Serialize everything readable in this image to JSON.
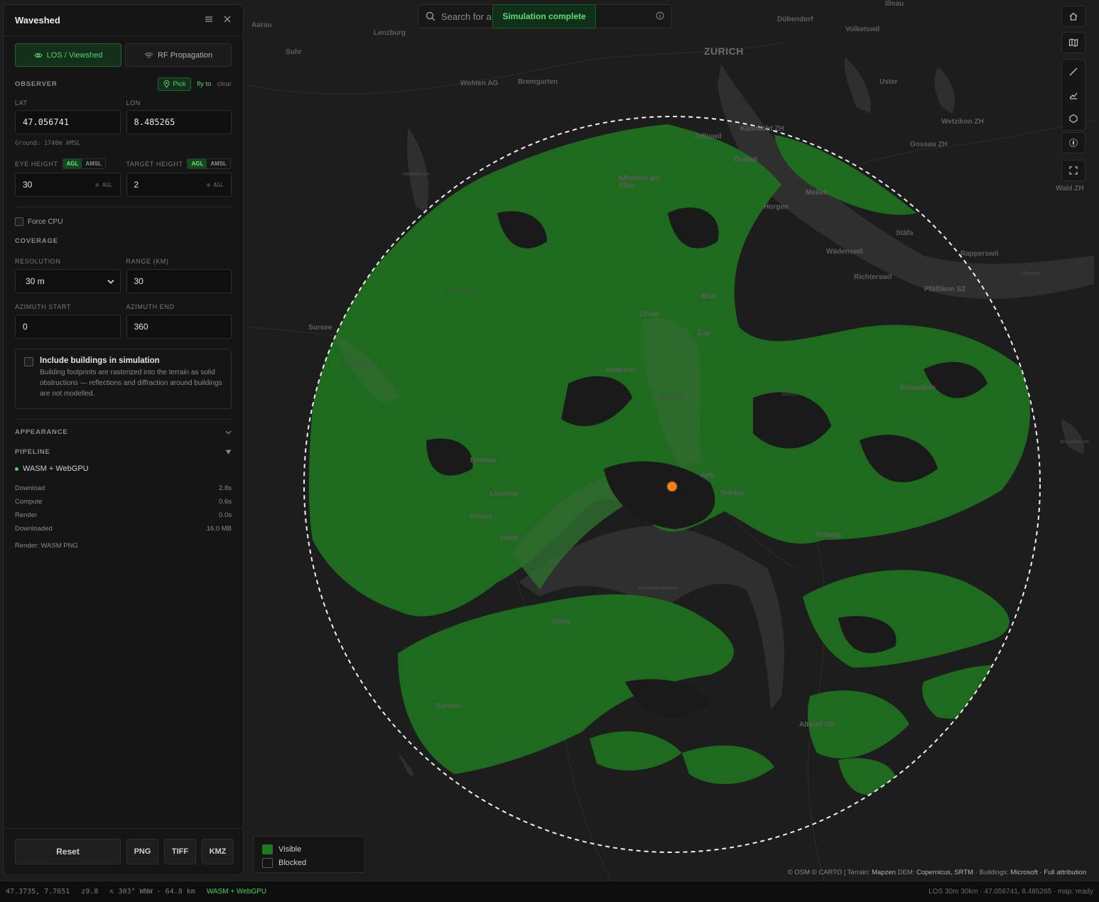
{
  "panel": {
    "title": "Waveshed",
    "tabs": [
      {
        "label": "LOS / Viewshed",
        "icon": "eye-icon",
        "active": true
      },
      {
        "label": "RF Propagation",
        "icon": "wifi-icon",
        "active": false
      }
    ],
    "observer": {
      "section": "OBSERVER",
      "pick": "Pick",
      "fly_to": "fly to",
      "clear": "clear",
      "lat_label": "LAT",
      "lon_label": "LON",
      "lat": "47.056741",
      "lon": "8.485265",
      "ground": "Ground: 1748m AMSL"
    },
    "heights": {
      "eye_label": "EYE HEIGHT",
      "target_label": "TARGET HEIGHT",
      "agl": "AGL",
      "amsl": "AMSL",
      "eye_value": "30",
      "target_value": "2",
      "unit": "m AGL"
    },
    "force_cpu": "Force CPU",
    "coverage": {
      "section": "COVERAGE",
      "resolution_label": "RESOLUTION",
      "resolution_value": "30 m",
      "range_label": "RANGE (KM)",
      "range_value": "30",
      "az_start_label": "AZIMUTH START",
      "az_start_value": "0",
      "az_end_label": "AZIMUTH END",
      "az_end_value": "360"
    },
    "buildings": {
      "title": "Include buildings in simulation",
      "desc": "Building footprints are rasterized into the terrain as solid obstructions — reflections and diffraction around buildings are not modelled."
    },
    "appearance": "APPEARANCE",
    "pipeline": {
      "section": "PIPELINE",
      "engine": "WASM + WebGPU",
      "stats": [
        {
          "label": "Download",
          "value": "2.8s"
        },
        {
          "label": "Compute",
          "value": "0.6s"
        },
        {
          "label": "Render",
          "value": "0.0s"
        },
        {
          "label": "Downloaded",
          "value": "16.0 MB"
        }
      ],
      "render_mode": "Render: WASM PNG"
    },
    "buttons": {
      "reset": "Reset",
      "png": "PNG",
      "tiff": "TIFF",
      "kmz": "KMZ"
    }
  },
  "search": {
    "placeholder": "Search for a pla"
  },
  "toast": "Simulation complete",
  "legend": {
    "visible": "Visible",
    "blocked": "Blocked",
    "visible_color": "#1f7a1f"
  },
  "map_labels": [
    "Illnau",
    "Aarau",
    "Lenzburg",
    "Dübendorf",
    "Volketswil",
    "Suhr",
    "ZURICH",
    "Wohlen AG",
    "Bremgarten",
    "Uster",
    "Adliswil",
    "Küsnacht ZH",
    "Wetzikon ZH",
    "Gossau ZH",
    "Thalwil",
    "Affoltern am Albis",
    "Wald ZH",
    "Meilen",
    "Horgen",
    "Stäfa",
    "Wädenswil",
    "Rapperswil",
    "Richterswil",
    "Pfäffikon SZ",
    "Baar",
    "Cham",
    "Zug",
    "Sursee",
    "Rotkreuz",
    "Einsiedeln",
    "Emmen",
    "Lucerne",
    "Arth",
    "Goldau",
    "Kriens",
    "Horw",
    "Schwyz",
    "Stans",
    "Sarnen",
    "Altdorf UR",
    "Hallwilersee",
    "Baldeggersee",
    "Sempachersee",
    "Zugersee",
    "Sihlsee",
    "Vierwaldstättersee",
    "Obersee",
    "Wägitalersee"
  ],
  "attribution": {
    "prefix": "© OSM © CARTO | Terrain:",
    "terrain": "Mapzen",
    "dem_label": "DEM:",
    "dem": "Copernicus, SRTM",
    "buildings_label": "· Buildings:",
    "buildings": "Microsoft",
    "full": "· Full attribution"
  },
  "status": {
    "coords": "47.3735, 7.7651",
    "zoom": "z9.8",
    "bearing": "⇱ 303° WNW · 64.8 km",
    "engine": "WASM + WebGPU",
    "right": "LOS 30m 30km · 47.056741, 8.485265 · map: ready"
  }
}
